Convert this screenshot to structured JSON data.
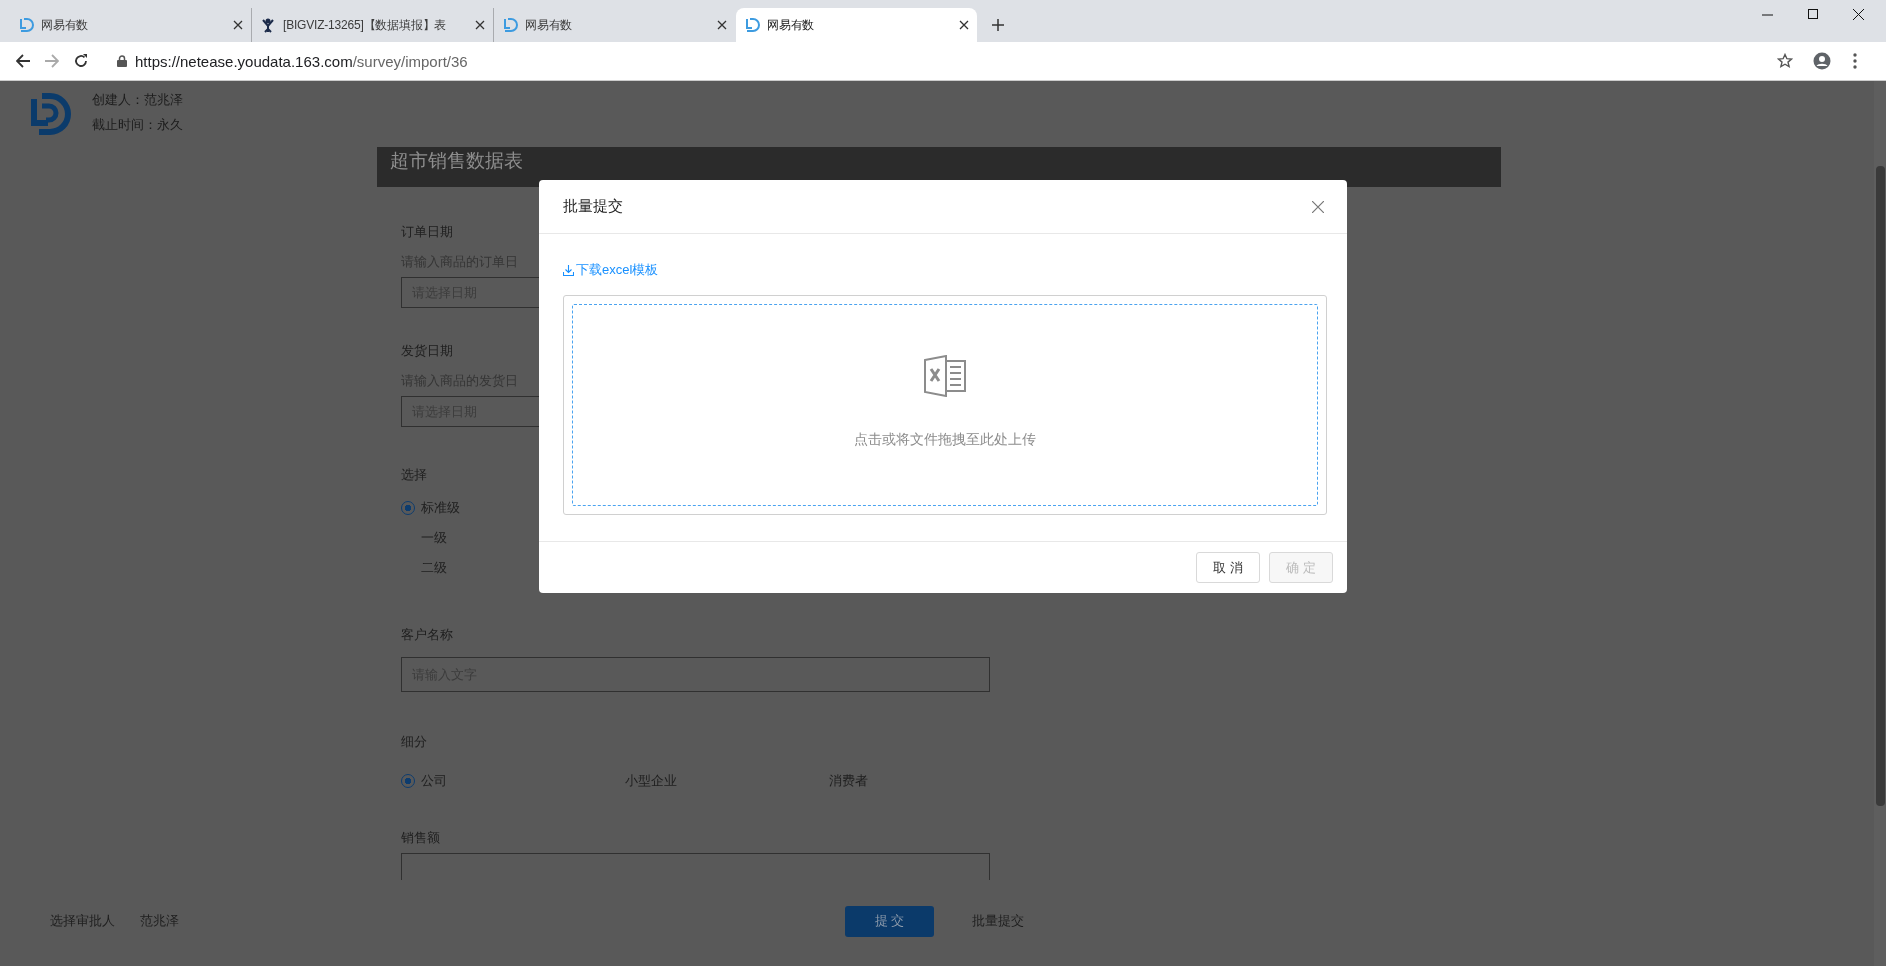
{
  "browser": {
    "tabs": [
      {
        "title": "网易有数",
        "kind": "logo",
        "selected": false
      },
      {
        "title": "[BIGVIZ-13265]【数据填报】表",
        "kind": "figure",
        "selected": false
      },
      {
        "title": "网易有数",
        "kind": "logo",
        "selected": false
      },
      {
        "title": "网易有数",
        "kind": "logo",
        "selected": true
      }
    ],
    "url": {
      "host": "https://netease.youdata.163.com",
      "path": "/survey/import/36"
    }
  },
  "header": {
    "creator": "创建人：范兆泽",
    "deadline": "截止时间：永久"
  },
  "form": {
    "title": "超市销售数据表",
    "fields": [
      {
        "kind": "date",
        "label": "订单日期",
        "hint": "请输入商品的订单日",
        "placeholder": "请选择日期"
      },
      {
        "kind": "date",
        "label": "发货日期",
        "hint": "请输入商品的发货日",
        "placeholder": "请选择日期"
      },
      {
        "kind": "radio_list",
        "label": "选择",
        "options": [
          {
            "label": "标准级",
            "selected": true
          },
          {
            "label": "一级",
            "selected": false
          },
          {
            "label": "二级",
            "selected": false
          }
        ]
      },
      {
        "kind": "text",
        "label": "客户名称",
        "placeholder": "请输入文字"
      },
      {
        "kind": "radio_row",
        "label": "细分",
        "options": [
          {
            "label": "公司",
            "selected": true
          },
          {
            "label": "小型企业",
            "selected": false
          },
          {
            "label": "消费者",
            "selected": false
          }
        ]
      },
      {
        "kind": "text",
        "label": "销售额"
      }
    ]
  },
  "footer": {
    "approver_label": "选择审批人",
    "approver": "范兆泽",
    "submit": "提 交",
    "batch": "批量提交"
  },
  "modal": {
    "title": "批量提交",
    "download_link": "下载excel模板",
    "upload_hint": "点击或将文件拖拽至此处上传",
    "buttons": [
      {
        "label": "取 消",
        "disabled": false
      },
      {
        "label": "确 定",
        "disabled": true
      }
    ]
  }
}
